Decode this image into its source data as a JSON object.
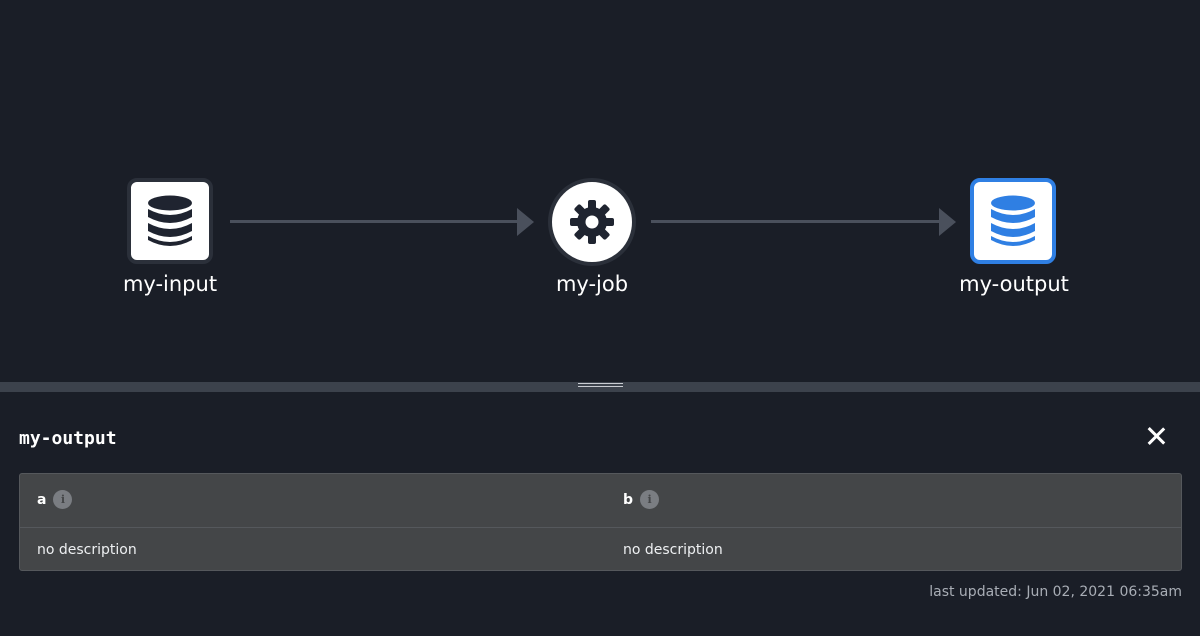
{
  "graph": {
    "nodes": [
      {
        "id": "input",
        "label": "my-input",
        "type": "dataset",
        "icon": "database-icon"
      },
      {
        "id": "job",
        "label": "my-job",
        "type": "job",
        "icon": "gear-icon"
      },
      {
        "id": "output",
        "label": "my-output",
        "type": "dataset",
        "icon": "database-icon",
        "selected": true
      }
    ],
    "colors": {
      "edge": "#4a505c",
      "selected": "#2f7fe3",
      "icon_default": "#1f2430",
      "icon_selected": "#2f7fe3"
    }
  },
  "panel": {
    "title": "my-output",
    "fields": {
      "headers": [
        "a",
        "b"
      ],
      "rows": [
        [
          "no description",
          "no description"
        ]
      ]
    },
    "last_updated": "last updated: Jun 02, 2021 06:35am"
  }
}
